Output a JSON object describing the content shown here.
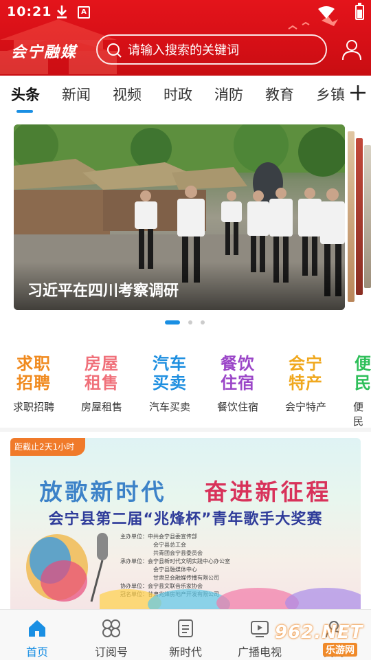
{
  "status_bar": {
    "time": "10:21",
    "notification_badge": "A"
  },
  "header": {
    "logo_text": "会宁融媒",
    "search_placeholder": "请输入搜索的关键词"
  },
  "tabs": [
    "头条",
    "新闻",
    "视频",
    "时政",
    "消防",
    "教育",
    "乡镇"
  ],
  "active_tab": "头条",
  "carousel": {
    "title": "习近平在四川考察调研",
    "page_count": 3,
    "active_index": 0
  },
  "services": [
    {
      "icon_text": "求职\n招聘",
      "label": "求职招聘",
      "color": "#f08a1e"
    },
    {
      "icon_text": "房屋\n租售",
      "label": "房屋租售",
      "color": "#f0707a"
    },
    {
      "icon_text": "汽车\n买卖",
      "label": "汽车买卖",
      "color": "#1e8fe0"
    },
    {
      "icon_text": "餐饮\n住宿",
      "label": "餐饮住宿",
      "color": "#9b46c8"
    },
    {
      "icon_text": "会宁\n特产",
      "label": "会宁特产",
      "color": "#f0a81e"
    },
    {
      "icon_text": "便民",
      "label": "便民",
      "color": "#2fbf5a"
    }
  ],
  "banner": {
    "deadline": "距截止2天1小时",
    "slogan_part1": "放歌新时代",
    "slogan_part2": "奋进新征程",
    "title": "会宁县第二届“兆烽杯”青年歌手大奖赛",
    "organizers": [
      "主办单位：中共会宁县委宣传部",
      "会宁县总工会",
      "共青团会宁县委员会",
      "承办单位：会宁县新时代文明实践中心办公室",
      "会宁县融媒体中心",
      "甘肃昱会融媒传播有限公司",
      "协办单位：会宁县文联音乐家协会",
      "冠名单位：甘肃兆烽房地产开发有限公司"
    ]
  },
  "bottom_nav": [
    {
      "label": "首页",
      "icon": "home-icon",
      "active": true
    },
    {
      "label": "订阅号",
      "icon": "grid-icon",
      "active": false
    },
    {
      "label": "新时代",
      "icon": "document-icon",
      "active": false
    },
    {
      "label": "广播电视",
      "icon": "tv-icon",
      "active": false
    },
    {
      "label": "我的",
      "icon": "profile-icon",
      "active": false
    }
  ],
  "watermark": {
    "text": "962.NET",
    "sub": "乐游网"
  },
  "colors": {
    "brand_red": "#d50f16",
    "accent_blue": "#1a8fe3",
    "deadline_orange": "#f07a2a"
  }
}
